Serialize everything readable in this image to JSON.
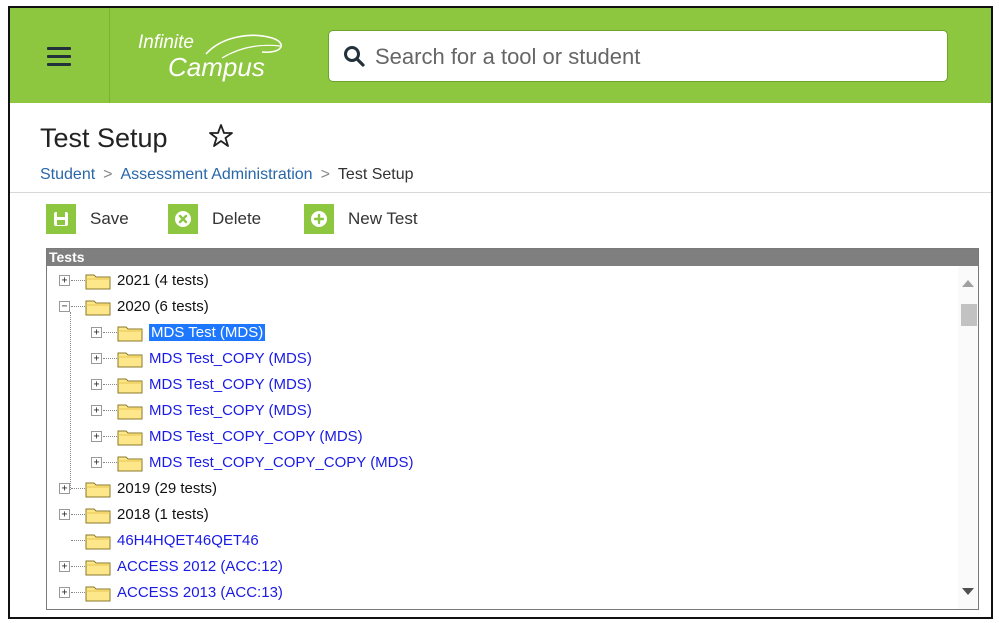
{
  "app": {
    "logo_line1": "Infinite",
    "logo_line2": "Campus",
    "accent_color": "#8dc63f"
  },
  "search": {
    "placeholder": "Search for a tool or student",
    "value": ""
  },
  "page": {
    "title": "Test Setup",
    "favorite_icon": "star-outline-icon"
  },
  "breadcrumb": {
    "items": [
      "Student",
      "Assessment Administration",
      "Test Setup"
    ],
    "separator": ">"
  },
  "toolbar": {
    "save_label": "Save",
    "delete_label": "Delete",
    "new_test_label": "New Test"
  },
  "tree": {
    "header": "Tests",
    "rows": [
      {
        "label": "2021 (4 tests)",
        "level": 0,
        "expander": "+",
        "style": "folder"
      },
      {
        "label": "2020 (6 tests)",
        "level": 0,
        "expander": "−",
        "style": "folder"
      },
      {
        "label": "MDS Test (MDS)",
        "level": 1,
        "expander": "+",
        "style": "selected"
      },
      {
        "label": "MDS Test_COPY (MDS)",
        "level": 1,
        "expander": "+",
        "style": "link"
      },
      {
        "label": "MDS Test_COPY (MDS)",
        "level": 1,
        "expander": "+",
        "style": "link"
      },
      {
        "label": "MDS Test_COPY (MDS)",
        "level": 1,
        "expander": "+",
        "style": "link"
      },
      {
        "label": "MDS Test_COPY_COPY (MDS)",
        "level": 1,
        "expander": "+",
        "style": "link"
      },
      {
        "label": "MDS Test_COPY_COPY_COPY (MDS)",
        "level": 1,
        "expander": "+",
        "style": "link"
      },
      {
        "label": "2019 (29 tests)",
        "level": 0,
        "expander": "+",
        "style": "folder"
      },
      {
        "label": "2018 (1 tests)",
        "level": 0,
        "expander": "+",
        "style": "folder"
      },
      {
        "label": "46H4HQET46QET46",
        "level": 0,
        "expander": "",
        "style": "link"
      },
      {
        "label": "ACCESS 2012 (ACC:12)",
        "level": 0,
        "expander": "+",
        "style": "link"
      },
      {
        "label": "ACCESS 2013 (ACC:13)",
        "level": 0,
        "expander": "+",
        "style": "link"
      }
    ]
  }
}
